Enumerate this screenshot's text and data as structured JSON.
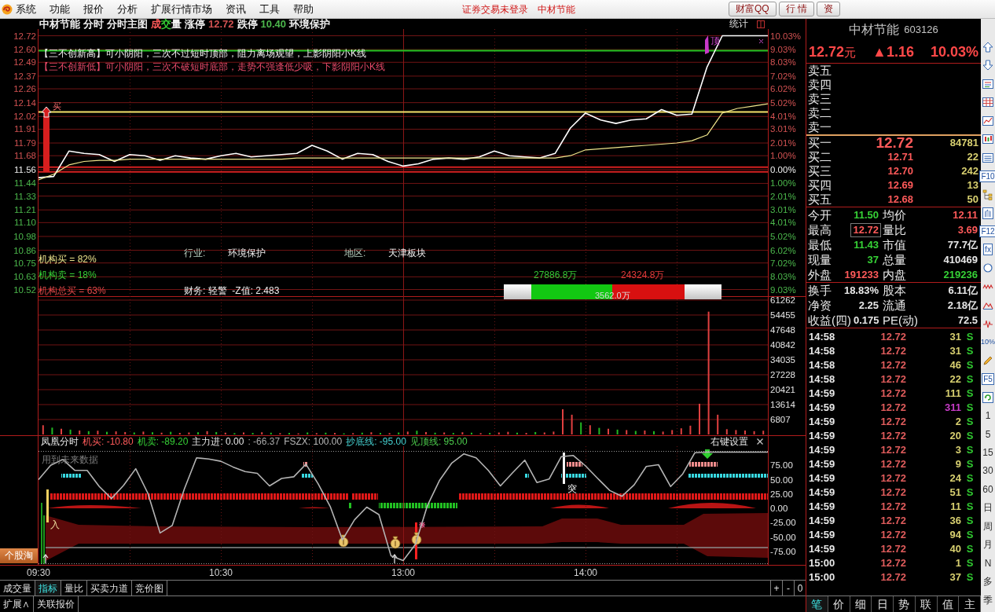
{
  "menu_bar": {
    "items": [
      "系统",
      "功能",
      "报价",
      "分析",
      "扩展行情市场",
      "资讯",
      "工具",
      "帮助"
    ],
    "status": "证券交易未登录",
    "stock": "中材节能",
    "buttons": [
      "财富QQ",
      "行 情",
      "资"
    ]
  },
  "chart": {
    "header": [
      {
        "text": "中材节能",
        "color": "#f0f0f0"
      },
      {
        "text": "分时",
        "color": "#f0f0f0"
      },
      {
        "text": "分时主图",
        "color": "#f0f0f0"
      },
      {
        "segments": [
          {
            "text": "成",
            "color": "#ff5a5a"
          },
          {
            "text": "交",
            "color": "#36d236"
          },
          {
            "text": "量",
            "color": "#f0f0f0"
          }
        ]
      },
      {
        "text": "涨停",
        "color": "#f0f0f0"
      },
      {
        "text": "12.72",
        "color": "#d25252"
      },
      {
        "text": "跌停",
        "color": "#f0f0f0"
      },
      {
        "text": "10.40",
        "color": "#4cb84c"
      },
      {
        "text": "环境保护",
        "color": "#f0f0f0"
      }
    ],
    "stats_label": "统计",
    "price_panel": {
      "notes": [
        {
          "text": "【三不创新高】可小阴阳，三次不过短时顶部，阻力离场观望，上影阴阳小K线",
          "color": "#f0f0f0"
        },
        {
          "text": "【三不创新低】可小阴阳，三次不破短时底部，走势不强逢低少吸，下影阴阳小K线",
          "color": "#e84a6a"
        }
      ],
      "info": [
        {
          "label": "行业:",
          "value": "环境保护"
        },
        {
          "label": "地区:",
          "value": "天津板块"
        }
      ],
      "institutions": [
        {
          "text": "机构买 = 82%",
          "color": "#e8e08a"
        },
        {
          "text": "机构卖 = 18%",
          "color": "#36d236"
        },
        {
          "text": "机构总买 = 63%",
          "color": "#e04848"
        }
      ],
      "finance": "财务: 轻警  -Z值: 2.483",
      "flow": {
        "buy": "27886.8万",
        "sell": "24324.8万",
        "net": "3562.0万",
        "level": 0.53
      },
      "top_mark": "顶",
      "buy_mark": "买",
      "right_axis": [
        {
          "label": "10.03%",
          "color": "#d25252"
        },
        {
          "label": "9.03%",
          "color": "#d25252"
        },
        {
          "label": "8.03%",
          "color": "#d25252"
        },
        {
          "label": "7.02%",
          "color": "#d25252"
        },
        {
          "label": "6.02%",
          "color": "#d25252"
        },
        {
          "label": "5.02%",
          "color": "#d25252"
        },
        {
          "label": "4.01%",
          "color": "#d25252"
        },
        {
          "label": "3.01%",
          "color": "#d25252"
        },
        {
          "label": "2.01%",
          "color": "#d25252"
        },
        {
          "label": "1.00%",
          "color": "#d25252"
        },
        {
          "label": "0.00%",
          "color": "#f0f0f0"
        },
        {
          "label": "1.00%",
          "color": "#4cb84c"
        },
        {
          "label": "2.01%",
          "color": "#4cb84c"
        },
        {
          "label": "3.01%",
          "color": "#4cb84c"
        },
        {
          "label": "4.01%",
          "color": "#4cb84c"
        },
        {
          "label": "5.02%",
          "color": "#4cb84c"
        },
        {
          "label": "6.02%",
          "color": "#4cb84c"
        },
        {
          "label": "7.02%",
          "color": "#4cb84c"
        },
        {
          "label": "8.03%",
          "color": "#4cb84c"
        },
        {
          "label": "9.03%",
          "color": "#4cb84c"
        }
      ],
      "chart_data": {
        "type": "line",
        "grid": true,
        "categories": [
          null,
          null,
          null,
          null,
          null,
          null,
          null,
          null,
          null,
          null,
          null,
          null,
          null,
          null,
          null,
          null,
          null,
          null,
          null,
          null,
          null,
          null,
          null,
          null,
          null,
          null,
          null,
          null,
          null,
          null,
          null,
          null,
          null,
          null,
          null,
          null,
          null,
          null,
          null,
          null,
          null,
          null,
          null,
          null,
          null,
          null,
          null,
          null,
          null
        ],
        "ylim": [
          10.52,
          12.72
        ],
        "series": [
          {
            "color": "#ffffff",
            "values": [
              11.49,
              11.5,
              11.72,
              11.7,
              11.69,
              11.63,
              11.69,
              11.68,
              11.64,
              11.68,
              11.66,
              11.65,
              11.68,
              11.7,
              11.67,
              11.68,
              11.69,
              11.7,
              11.77,
              11.72,
              11.65,
              11.7,
              11.69,
              11.63,
              11.59,
              11.61,
              11.65,
              11.66,
              11.65,
              11.67,
              11.72,
              11.68,
              11.67,
              11.66,
              11.7,
              11.92,
              12.05,
              11.99,
              11.96,
              11.99,
              12.0,
              12.08,
              12.03,
              12.04,
              12.45,
              12.72,
              12.72,
              12.72,
              12.72
            ]
          },
          {
            "color": "#f0e68c",
            "values": [
              11.47,
              11.52,
              11.6,
              11.63,
              11.64,
              11.64,
              11.65,
              11.65,
              11.65,
              11.65,
              11.65,
              11.65,
              11.65,
              11.65,
              11.65,
              11.65,
              11.65,
              11.66,
              11.66,
              11.66,
              11.66,
              11.66,
              11.66,
              11.66,
              11.66,
              11.66,
              11.66,
              11.66,
              11.66,
              11.66,
              11.66,
              11.66,
              11.66,
              11.66,
              11.66,
              11.68,
              11.73,
              11.74,
              11.75,
              11.76,
              11.77,
              11.78,
              11.79,
              11.81,
              11.86,
              12.05,
              12.09,
              12.11,
              12.13
            ]
          }
        ],
        "yticks": [
          {
            "value": 12.72,
            "label": "12.72"
          },
          {
            "value": 12.6,
            "label": "12.60"
          },
          {
            "value": 12.49,
            "label": "12.49"
          },
          {
            "value": 12.37,
            "label": "12.37"
          },
          {
            "value": 12.26,
            "label": "12.26"
          },
          {
            "value": 12.14,
            "label": "12.14"
          },
          {
            "value": 12.02,
            "label": "12.02"
          },
          {
            "value": 11.91,
            "label": "11.91"
          },
          {
            "value": 11.79,
            "label": "11.79"
          },
          {
            "value": 11.68,
            "label": "11.68"
          },
          {
            "value": 11.56,
            "label": "11.56"
          },
          {
            "value": 11.44,
            "label": "11.44"
          },
          {
            "value": 11.33,
            "label": "11.33"
          },
          {
            "value": 11.21,
            "label": "11.21"
          },
          {
            "value": 11.1,
            "label": "11.10"
          },
          {
            "value": 10.98,
            "label": "10.98"
          },
          {
            "value": 10.86,
            "label": "10.86"
          },
          {
            "value": 10.75,
            "label": "10.75"
          },
          {
            "value": 10.63,
            "label": "10.63"
          },
          {
            "value": 10.52,
            "label": "10.52"
          }
        ],
        "ref_lines": [
          {
            "axis": "y",
            "value": 12.59,
            "color": "#22c322"
          },
          {
            "axis": "y",
            "value": 12.06,
            "color": "#f5e36b"
          },
          {
            "axis": "y",
            "value": 11.58,
            "color": "#d42020"
          },
          {
            "axis": "y",
            "value": 11.54,
            "color": "#d42020"
          }
        ]
      }
    },
    "volume_panel": {
      "chart_data": {
        "type": "bar",
        "grid": true,
        "categories": [
          null,
          null,
          null,
          null,
          null,
          null,
          null,
          null,
          null,
          null,
          null,
          null,
          null,
          null,
          null,
          null,
          null,
          null,
          null,
          null,
          null,
          null,
          null,
          null,
          null,
          null,
          null,
          null,
          null,
          null,
          null,
          null,
          null,
          null,
          null,
          null,
          null,
          null,
          null,
          null,
          null,
          null,
          null,
          null,
          null,
          null,
          null,
          null,
          null,
          null,
          null,
          null,
          null,
          null,
          null,
          null,
          null,
          null,
          null,
          null,
          null,
          null,
          null,
          null,
          null,
          null,
          null,
          null,
          null,
          null,
          null,
          null,
          null,
          null,
          null,
          null,
          null,
          null,
          null,
          null
        ],
        "ylim": [
          0,
          63053
        ],
        "yticks": [
          {
            "value": 6807,
            "label": "6807"
          },
          {
            "value": 13614,
            "label": "13614"
          },
          {
            "value": 20421,
            "label": "20421"
          },
          {
            "value": 27228,
            "label": "27228"
          },
          {
            "value": 34035,
            "label": "34035"
          },
          {
            "value": 40842,
            "label": "40842"
          },
          {
            "value": 47648,
            "label": "47648"
          },
          {
            "value": 54455,
            "label": "54455"
          },
          {
            "value": 61262,
            "label": "61262"
          }
        ],
        "series": [
          {
            "color": "#e04040",
            "values": [
              4200,
              null,
              2600,
              null,
              1800,
              null,
              1700,
              null,
              1400,
              1100,
              null,
              1300,
              null,
              800,
              null,
              700,
              900,
              null,
              1500,
              null,
              800,
              null,
              900,
              null,
              1000,
              null,
              600,
              null,
              500,
              null,
              600,
              null,
              700,
              null,
              600,
              null,
              1000,
              null,
              600,
              null,
              1300,
              null,
              1100,
              null,
              900,
              null,
              1000,
              null,
              600,
              null,
              900,
              1200,
              null,
              700,
              null,
              900,
              1300,
              11500,
              9000,
              null,
              4200,
              null,
              2600,
              null,
              2000,
              null,
              1800,
              null,
              1300,
              2000,
              2800,
              4000,
              14000,
              56000,
              9000,
              2400,
              2000,
              1800,
              1500,
              1700
            ]
          },
          {
            "color": "#22b822",
            "values": [
              null,
              3100,
              null,
              2200,
              null,
              1500,
              null,
              1200,
              null,
              null,
              900,
              null,
              1000,
              null,
              1200,
              null,
              null,
              1000,
              null,
              1100,
              null,
              600,
              null,
              700,
              null,
              800,
              null,
              700,
              null,
              900,
              null,
              800,
              null,
              500,
              null,
              800,
              null,
              700,
              null,
              900,
              null,
              1700,
              null,
              800,
              null,
              700,
              null,
              800,
              null,
              700,
              null,
              null,
              800,
              null,
              1100,
              null,
              null,
              null,
              null,
              5500,
              null,
              3000,
              null,
              2200,
              null,
              1600,
              null,
              1500,
              null,
              null,
              null,
              null,
              null,
              null,
              null,
              null,
              null,
              null,
              null,
              null
            ]
          }
        ]
      }
    },
    "indicator_panel": {
      "readings": [
        {
          "text": "机买: -10.80",
          "color": "#ff5a5a"
        },
        {
          "text": "机卖: -89.20",
          "color": "#36d236"
        },
        {
          "text": "主力进: 0.00",
          "color": "#e8e8e8"
        },
        {
          "text": ": -66.37",
          "color": "#a8a8a8"
        },
        {
          "text": "FSZX: 100.00",
          "color": "#b8b8b8"
        },
        {
          "text": "抄底线: -95.00",
          "color": "#45d0d0"
        },
        {
          "text": "见顶线: 95.00",
          "color": "#4ccc4c"
        }
      ],
      "settings": "右键设置",
      "note": "用到未来数据",
      "entry_mark": "入",
      "breakout_mark": "突",
      "side_button": "个股淘",
      "chart_data": {
        "type": "line",
        "grid": true,
        "categories": [
          "09:30",
          null,
          null,
          null,
          null,
          null,
          null,
          null,
          null,
          null,
          null,
          null,
          null,
          null,
          null,
          "10:30",
          null,
          null,
          null,
          null,
          null,
          null,
          null,
          null,
          null,
          null,
          null,
          null,
          null,
          null,
          "13:00",
          null,
          null,
          null,
          null,
          null,
          null,
          null,
          null,
          null,
          null,
          null,
          null,
          null,
          null,
          "14:00",
          null,
          null,
          null,
          null,
          null,
          null,
          null,
          null,
          null,
          null,
          null,
          null,
          null,
          null,
          null
        ],
        "ylim": [
          -100,
          100
        ],
        "series": [
          {
            "name": "凤凰分时",
            "color": "#b4b4b4",
            "values": [
              50,
              75,
              85,
              66,
              66,
              38,
              17,
              40,
              69,
              26,
              -43,
              -30,
              34,
              88,
              86,
              82,
              72,
              64,
              61,
              39,
              52,
              55,
              77,
              43,
              3,
              -55,
              -20,
              2,
              -11,
              -83,
              -91,
              -63,
              5,
              49,
              79,
              95,
              88,
              66,
              39,
              62,
              84,
              45,
              51,
              90,
              92,
              74,
              52,
              31,
              21,
              41,
              73,
              76,
              38,
              60,
              97,
              98,
              98,
              98,
              98,
              98,
              98
            ]
          }
        ],
        "yticks": [
          {
            "value": 75,
            "label": "75.00"
          },
          {
            "value": 50,
            "label": "50.00"
          },
          {
            "value": 25,
            "label": "25.00"
          },
          {
            "value": 0,
            "label": "0.00"
          },
          {
            "value": -25,
            "label": "-25.00"
          },
          {
            "value": -50,
            "label": "-50.00"
          },
          {
            "value": -75,
            "label": "-75.00"
          }
        ]
      }
    },
    "tabs": [
      {
        "label": "成交量",
        "selected": false
      },
      {
        "label": "指标",
        "selected": true
      },
      {
        "label": "量比",
        "selected": false
      },
      {
        "label": "买卖力道",
        "selected": false
      },
      {
        "label": "竞价图",
        "selected": false
      }
    ],
    "zoom_buttons": [
      "+",
      "-",
      "0"
    ],
    "bottom_tabs": [
      "扩展∧",
      "关联报价"
    ]
  },
  "quote": {
    "name": "中材节能",
    "code": "603126",
    "price": "12.72",
    "unit": "元",
    "change": "▲1.16",
    "change_pct": "10.03%",
    "asks": [
      "卖五",
      "卖四",
      "卖三",
      "卖二",
      "卖一"
    ],
    "bids": [
      {
        "label": "买一",
        "price": "12.72",
        "volume": "84781"
      },
      {
        "label": "买二",
        "price": "12.71",
        "volume": "22"
      },
      {
        "label": "买三",
        "price": "12.70",
        "volume": "242"
      },
      {
        "label": "买四",
        "price": "12.69",
        "volume": "13"
      },
      {
        "label": "买五",
        "price": "12.68",
        "volume": "50"
      }
    ],
    "stats": [
      [
        {
          "label": "今开",
          "value": "11.50",
          "color": "#36d236",
          "boxed": false
        },
        {
          "label": "均价",
          "value": "12.11",
          "color": "#ff5a5a",
          "boxed": false
        }
      ],
      [
        {
          "label": "最高",
          "value": "12.72",
          "color": "#ff5a5a",
          "boxed": true
        },
        {
          "label": "量比",
          "value": "3.69",
          "color": "#ff5a5a",
          "boxed": false
        }
      ],
      [
        {
          "label": "最低",
          "value": "11.43",
          "color": "#36d236",
          "boxed": false
        },
        {
          "label": "市值",
          "value": "77.7亿",
          "color": "#e8e8e8",
          "boxed": false
        }
      ],
      [
        {
          "label": "现量",
          "value": "37",
          "color": "#36d236",
          "boxed": false
        },
        {
          "label": "总量",
          "value": "410469",
          "color": "#e8e8e8",
          "boxed": false
        }
      ],
      [
        {
          "label": "外盘",
          "value": "191233",
          "color": "#ff5a5a",
          "boxed": false
        },
        {
          "label": "内盘",
          "value": "219236",
          "color": "#36d236",
          "boxed": false
        }
      ]
    ],
    "fundamentals": [
      [
        {
          "label": "换手",
          "value": "18.83%"
        },
        {
          "label": "股本",
          "value": "6.11亿"
        }
      ],
      [
        {
          "label": "净资",
          "value": "2.25"
        },
        {
          "label": "流通",
          "value": "2.18亿"
        }
      ],
      [
        {
          "label": "收益(四)",
          "value": "0.175"
        },
        {
          "label": "PE(动)",
          "value": "72.5"
        }
      ]
    ],
    "ticks": [
      {
        "time": "14:58",
        "price": "12.72",
        "volume": "31",
        "side": "S",
        "large": false
      },
      {
        "time": "14:58",
        "price": "12.72",
        "volume": "31",
        "side": "S",
        "large": false
      },
      {
        "time": "14:58",
        "price": "12.72",
        "volume": "46",
        "side": "S",
        "large": false
      },
      {
        "time": "14:58",
        "price": "12.72",
        "volume": "22",
        "side": "S",
        "large": false
      },
      {
        "time": "14:59",
        "price": "12.72",
        "volume": "111",
        "side": "S",
        "large": false
      },
      {
        "time": "14:59",
        "price": "12.72",
        "volume": "311",
        "side": "S",
        "large": true
      },
      {
        "time": "14:59",
        "price": "12.72",
        "volume": "2",
        "side": "S",
        "large": false
      },
      {
        "time": "14:59",
        "price": "12.72",
        "volume": "20",
        "side": "S",
        "large": false
      },
      {
        "time": "14:59",
        "price": "12.72",
        "volume": "3",
        "side": "S",
        "large": false
      },
      {
        "time": "14:59",
        "price": "12.72",
        "volume": "9",
        "side": "S",
        "large": false
      },
      {
        "time": "14:59",
        "price": "12.72",
        "volume": "24",
        "side": "S",
        "large": false
      },
      {
        "time": "14:59",
        "price": "12.72",
        "volume": "51",
        "side": "S",
        "large": false
      },
      {
        "time": "14:59",
        "price": "12.72",
        "volume": "11",
        "side": "S",
        "large": false
      },
      {
        "time": "14:59",
        "price": "12.72",
        "volume": "36",
        "side": "S",
        "large": false
      },
      {
        "time": "14:59",
        "price": "12.72",
        "volume": "94",
        "side": "S",
        "large": false
      },
      {
        "time": "14:59",
        "price": "12.72",
        "volume": "40",
        "side": "S",
        "large": false
      },
      {
        "time": "15:00",
        "price": "12.72",
        "volume": "1",
        "side": "S",
        "large": false
      },
      {
        "time": "15:00",
        "price": "12.72",
        "volume": "37",
        "side": "S",
        "large": false
      }
    ],
    "tabs": [
      {
        "label": "笔",
        "selected": true
      },
      {
        "label": "价",
        "selected": false
      },
      {
        "label": "细",
        "selected": false
      },
      {
        "label": "日",
        "selected": false
      },
      {
        "label": "势",
        "selected": false
      },
      {
        "label": "联",
        "selected": false
      },
      {
        "label": "值",
        "selected": false
      },
      {
        "label": "主",
        "selected": false
      }
    ]
  },
  "toolbar": {
    "keys": [
      "F10",
      "自",
      "F12",
      "fx"
    ],
    "ratio": "10%",
    "refresh_key": "F5",
    "periods": [
      "1",
      "5",
      "15",
      "30",
      "60",
      "日",
      "周",
      "月",
      "N",
      "多",
      "季"
    ]
  }
}
